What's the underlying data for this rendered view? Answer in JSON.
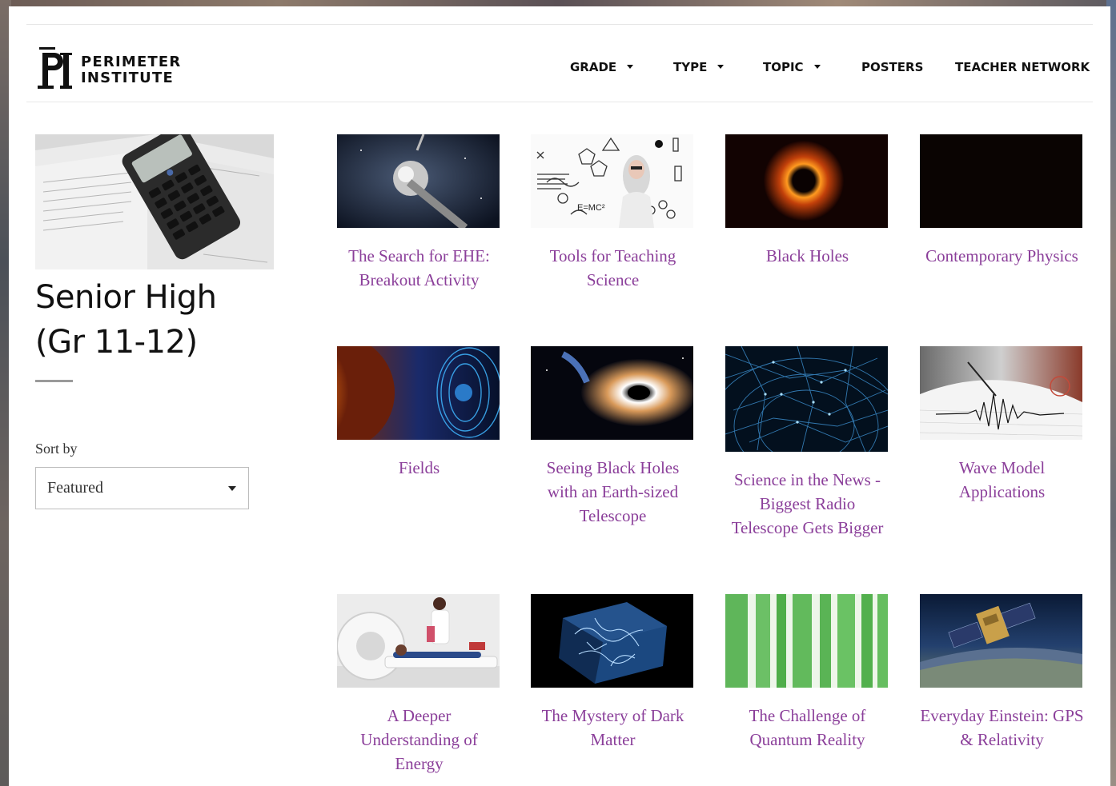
{
  "logo": {
    "mark": "PI",
    "line1": "PERIMETER",
    "line2": "INSTITUTE"
  },
  "nav": {
    "grade": "GRADE",
    "type": "TYPE",
    "topic": "TOPIC",
    "posters": "POSTERS",
    "teacher_network": "TEACHER NETWORK"
  },
  "sidebar": {
    "title_line1": "Senior High",
    "title_line2": "(Gr 11-12)",
    "sort_label": "Sort by",
    "sort_value": "Featured"
  },
  "cards": [
    {
      "title": "The Search for EHE: Breakout Activity"
    },
    {
      "title": "Tools for Teaching Science"
    },
    {
      "title": "Black Holes"
    },
    {
      "title": "Contemporary Physics"
    },
    {
      "title": "Fields"
    },
    {
      "title": "Seeing Black Holes with an Earth-sized Telescope"
    },
    {
      "title": "Science in the News - Biggest Radio Telescope Gets Bigger"
    },
    {
      "title": "Wave Model Applications"
    },
    {
      "title": "A Deeper Understanding of Energy"
    },
    {
      "title": "The Mystery of Dark Matter"
    },
    {
      "title": "The Challenge of Quantum Reality"
    },
    {
      "title": "Everyday Einstein: GPS & Relativity"
    }
  ],
  "colors": {
    "card_title": "#8b3f9a",
    "nav_text": "#111111"
  }
}
